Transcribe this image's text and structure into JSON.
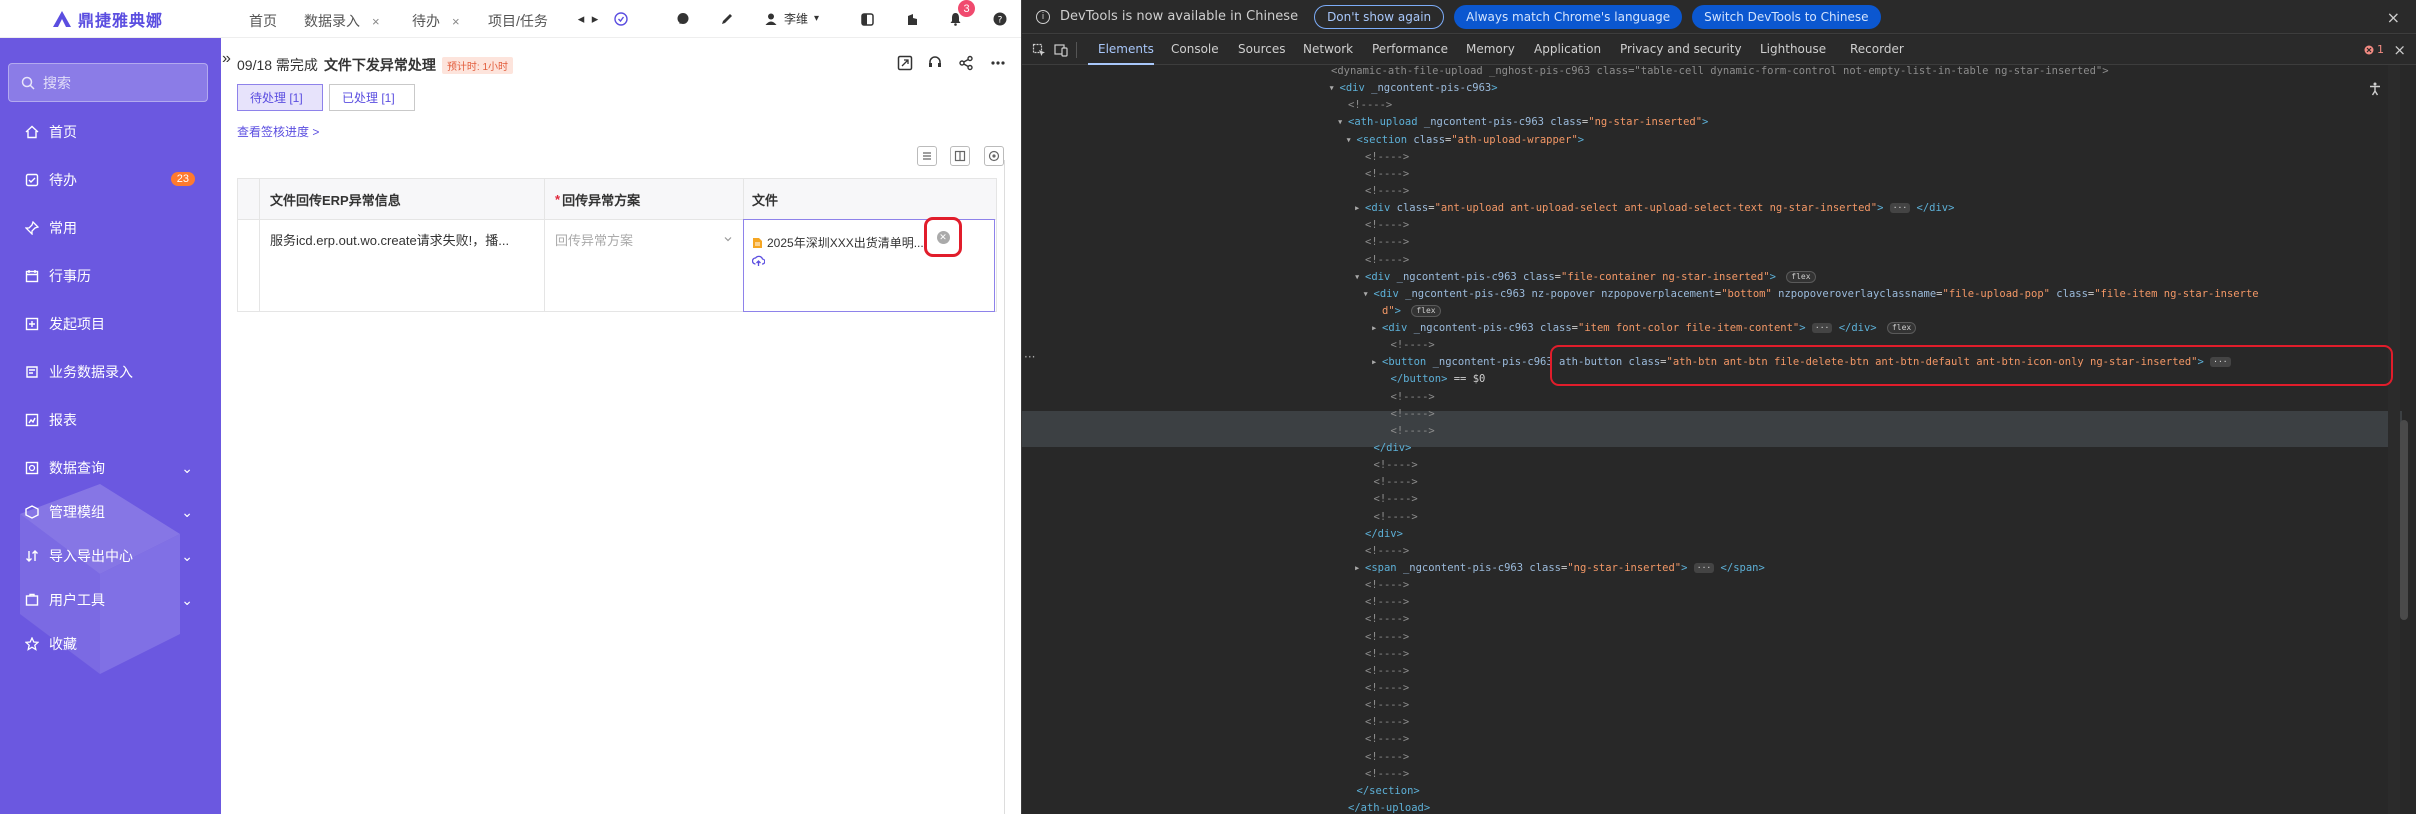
{
  "app": {
    "logo_text": "鼎捷雅典娜",
    "tabs": [
      {
        "label": "首页"
      },
      {
        "label": "数据录入",
        "close": "×"
      },
      {
        "label": "待办",
        "close": "×"
      },
      {
        "label": "项目/任务"
      }
    ],
    "tab_nav": {
      "prev": "◂",
      "next": "▸"
    },
    "notification_count": "3",
    "user_name": "李维",
    "user_caret": "▾"
  },
  "sidebar": {
    "search_placeholder": "搜索",
    "items": [
      {
        "label": "首页",
        "icon": "home-icon"
      },
      {
        "label": "待办",
        "icon": "todo-icon",
        "count": "23"
      },
      {
        "label": "常用",
        "icon": "pin-icon"
      },
      {
        "label": "行事历",
        "icon": "calendar-icon"
      },
      {
        "label": "发起项目",
        "icon": "launch-icon"
      },
      {
        "label": "业务数据录入",
        "icon": "data-entry-icon"
      },
      {
        "label": "报表",
        "icon": "report-icon"
      },
      {
        "label": "数据查询",
        "icon": "query-icon",
        "expandable": true
      },
      {
        "label": "管理模组",
        "icon": "module-icon",
        "expandable": true
      },
      {
        "label": "导入导出中心",
        "icon": "import-export-icon",
        "expandable": true
      },
      {
        "label": "用户工具",
        "icon": "tools-icon",
        "expandable": true
      },
      {
        "label": "收藏",
        "icon": "star-icon"
      }
    ],
    "chevron": "⌄"
  },
  "task": {
    "collapse": "»",
    "date_prefix": "09/18 需完成",
    "title": "文件下发异常处理",
    "estimate": "预计时: 1小时",
    "subtabs": [
      {
        "label": "待处理 [1]",
        "active": true
      },
      {
        "label": "已处理 [1]",
        "active": false
      }
    ],
    "progress_link": "查看签核进度 >"
  },
  "table": {
    "headers": [
      "文件回传ERP异常信息",
      "回传异常方案",
      "文件"
    ],
    "required_mark": "*",
    "rows": [
      {
        "error": "服务icd.erp.out.wo.create请求失败!，播...",
        "plan_placeholder": "回传异常方案",
        "file_name": "2025年深圳XXX出货清单明..."
      }
    ]
  },
  "devtools": {
    "info_message": "DevTools is now available in Chinese",
    "btn_dont_show": "Don't show again",
    "btn_always_match": "Always match Chrome's language",
    "btn_switch": "Switch DevTools to Chinese",
    "close": "×",
    "tabs": [
      "Elements",
      "Console",
      "Sources",
      "Network",
      "Performance",
      "Memory",
      "Application",
      "Privacy and security",
      "Lighthouse",
      "Recorder"
    ],
    "active_tab": "Elements",
    "error_count": "1",
    "gutter": "···",
    "selected_suffix": "== $0",
    "flex_badge": "flex",
    "dots_badge": "···"
  },
  "dom_lines": [
    {
      "indent": 0,
      "html": "<span class='cmt'>&lt;dynamic-ath-file-upload _nghost-pis-c963 class=\"table-cell dynamic-form-control not-empty-list-in-table ng-star-inserted\"&gt;</span>"
    },
    {
      "indent": 1,
      "tri": "▾",
      "html": "<span class='tag'>&lt;div</span> <span class='attr'>_ngcontent-pis-c963</span><span class='tag'>&gt;</span>"
    },
    {
      "indent": 2,
      "html": "<span class='cmt'>&lt;!----&gt;</span>"
    },
    {
      "indent": 2,
      "tri": "▾",
      "html": "<span class='tag'>&lt;ath-upload</span> <span class='attr'>_ngcontent-pis-c963 class</span>=<span class='val'>\"ng-star-inserted\"</span><span class='tag'>&gt;</span>"
    },
    {
      "indent": 3,
      "tri": "▾",
      "html": "<span class='tag'>&lt;section</span> <span class='attr'>class</span>=<span class='val'>\"ath-upload-wrapper\"</span><span class='tag'>&gt;</span>"
    },
    {
      "indent": 4,
      "html": "<span class='cmt'>&lt;!----&gt;</span>"
    },
    {
      "indent": 4,
      "html": "<span class='cmt'>&lt;!----&gt;</span>"
    },
    {
      "indent": 4,
      "html": "<span class='cmt'>&lt;!----&gt;</span>"
    },
    {
      "indent": 4,
      "tri": "▸",
      "html": "<span class='tag'>&lt;div</span> <span class='attr'>class</span>=<span class='val'>\"ant-upload ant-upload-select ant-upload-select-text ng-star-inserted\"</span><span class='tag'>&gt;</span> <span class='dots-badge'>···</span> <span class='tag'>&lt;/div&gt;</span>"
    },
    {
      "indent": 4,
      "html": "<span class='cmt'>&lt;!----&gt;</span>"
    },
    {
      "indent": 4,
      "html": "<span class='cmt'>&lt;!----&gt;</span>"
    },
    {
      "indent": 4,
      "html": "<span class='cmt'>&lt;!----&gt;</span>"
    },
    {
      "indent": 4,
      "tri": "▾",
      "html": "<span class='tag'>&lt;div</span> <span class='attr'>_ngcontent-pis-c963 class</span>=<span class='val'>\"file-container ng-star-inserted\"</span><span class='tag'>&gt;</span> <span class='flex-badge'>flex</span>"
    },
    {
      "indent": 5,
      "tri": "▾",
      "html": "<span class='tag'>&lt;div</span> <span class='attr'>_ngcontent-pis-c963 nz-popover nzpopoverplacement</span>=<span class='val'>\"bottom\"</span> <span class='attr'>nzpopoveroverlayclassname</span>=<span class='val'>\"file-upload-pop\"</span> <span class='attr'>class</span>=<span class='val'>\"file-item ng-star-inserte</span>"
    },
    {
      "indent": 6,
      "html": "<span class='val'>d\"</span><span class='tag'>&gt;</span> <span class='flex-badge'>flex</span>"
    },
    {
      "indent": 6,
      "tri": "▸",
      "html": "<span class='tag'>&lt;div</span> <span class='attr'>_ngcontent-pis-c963 class</span>=<span class='val'>\"item font-color file-item-content\"</span><span class='tag'>&gt;</span> <span class='dots-badge'>···</span> <span class='tag'>&lt;/div&gt;</span> <span class='flex-badge'>flex</span>"
    },
    {
      "indent": 7,
      "html": "<span class='cmt'>&lt;!----&gt;</span>"
    },
    {
      "indent": 6,
      "tri": "▸",
      "sel": true,
      "html": "<span class='tag'>&lt;button</span> <span class='attr'>_ngcontent-pis-c963 ath-button class</span>=<span class='val'>\"ath-btn ant-btn file-delete-btn ant-btn-default ant-btn-icon-only ng-star-inserted\"</span><span class='tag'>&gt;</span> <span class='dots-badge'>···</span>"
    },
    {
      "indent": 7,
      "sel": true,
      "html": "<span class='tag'>&lt;/button&gt;</span> <span style='color:#cfcfcf'>== $0</span>"
    },
    {
      "indent": 7,
      "html": "<span class='cmt'>&lt;!----&gt;</span>"
    },
    {
      "indent": 7,
      "html": "<span class='cmt'>&lt;!----&gt;</span>"
    },
    {
      "indent": 7,
      "html": "<span class='cmt'>&lt;!----&gt;</span>"
    },
    {
      "indent": 5,
      "html": "<span class='tag'>&lt;/div&gt;</span>"
    },
    {
      "indent": 5,
      "html": "<span class='cmt'>&lt;!----&gt;</span>"
    },
    {
      "indent": 5,
      "html": "<span class='cmt'>&lt;!----&gt;</span>"
    },
    {
      "indent": 5,
      "html": "<span class='cmt'>&lt;!----&gt;</span>"
    },
    {
      "indent": 5,
      "html": "<span class='cmt'>&lt;!----&gt;</span>"
    },
    {
      "indent": 4,
      "html": "<span class='tag'>&lt;/div&gt;</span>"
    },
    {
      "indent": 4,
      "html": "<span class='cmt'>&lt;!----&gt;</span>"
    },
    {
      "indent": 4,
      "tri": "▸",
      "html": "<span class='tag'>&lt;span</span> <span class='attr'>_ngcontent-pis-c963 class</span>=<span class='val'>\"ng-star-inserted\"</span><span class='tag'>&gt;</span> <span class='dots-badge'>···</span> <span class='tag'>&lt;/span&gt;</span>"
    },
    {
      "indent": 4,
      "html": "<span class='cmt'>&lt;!----&gt;</span>"
    },
    {
      "indent": 4,
      "html": "<span class='cmt'>&lt;!----&gt;</span>"
    },
    {
      "indent": 4,
      "html": "<span class='cmt'>&lt;!----&gt;</span>"
    },
    {
      "indent": 4,
      "html": "<span class='cmt'>&lt;!----&gt;</span>"
    },
    {
      "indent": 4,
      "html": "<span class='cmt'>&lt;!----&gt;</span>"
    },
    {
      "indent": 4,
      "html": "<span class='cmt'>&lt;!----&gt;</span>"
    },
    {
      "indent": 4,
      "html": "<span class='cmt'>&lt;!----&gt;</span>"
    },
    {
      "indent": 4,
      "html": "<span class='cmt'>&lt;!----&gt;</span>"
    },
    {
      "indent": 4,
      "html": "<span class='cmt'>&lt;!----&gt;</span>"
    },
    {
      "indent": 4,
      "html": "<span class='cmt'>&lt;!----&gt;</span>"
    },
    {
      "indent": 4,
      "html": "<span class='cmt'>&lt;!----&gt;</span>"
    },
    {
      "indent": 4,
      "html": "<span class='cmt'>&lt;!----&gt;</span>"
    },
    {
      "indent": 3,
      "html": "<span class='tag'>&lt;/section&gt;</span>"
    },
    {
      "indent": 2,
      "html": "<span class='tag'>&lt;/ath-upload&gt;</span>"
    },
    {
      "indent": 2,
      "html": "<span class='cmt'>&lt;!----&gt;</span>"
    }
  ],
  "colors": {
    "brand": "#6b58e0",
    "accent": "#5b4ee0",
    "badge_orange": "#ff7a2e",
    "highlight_red": "#e11d2b",
    "devtools_bg": "#282828"
  }
}
